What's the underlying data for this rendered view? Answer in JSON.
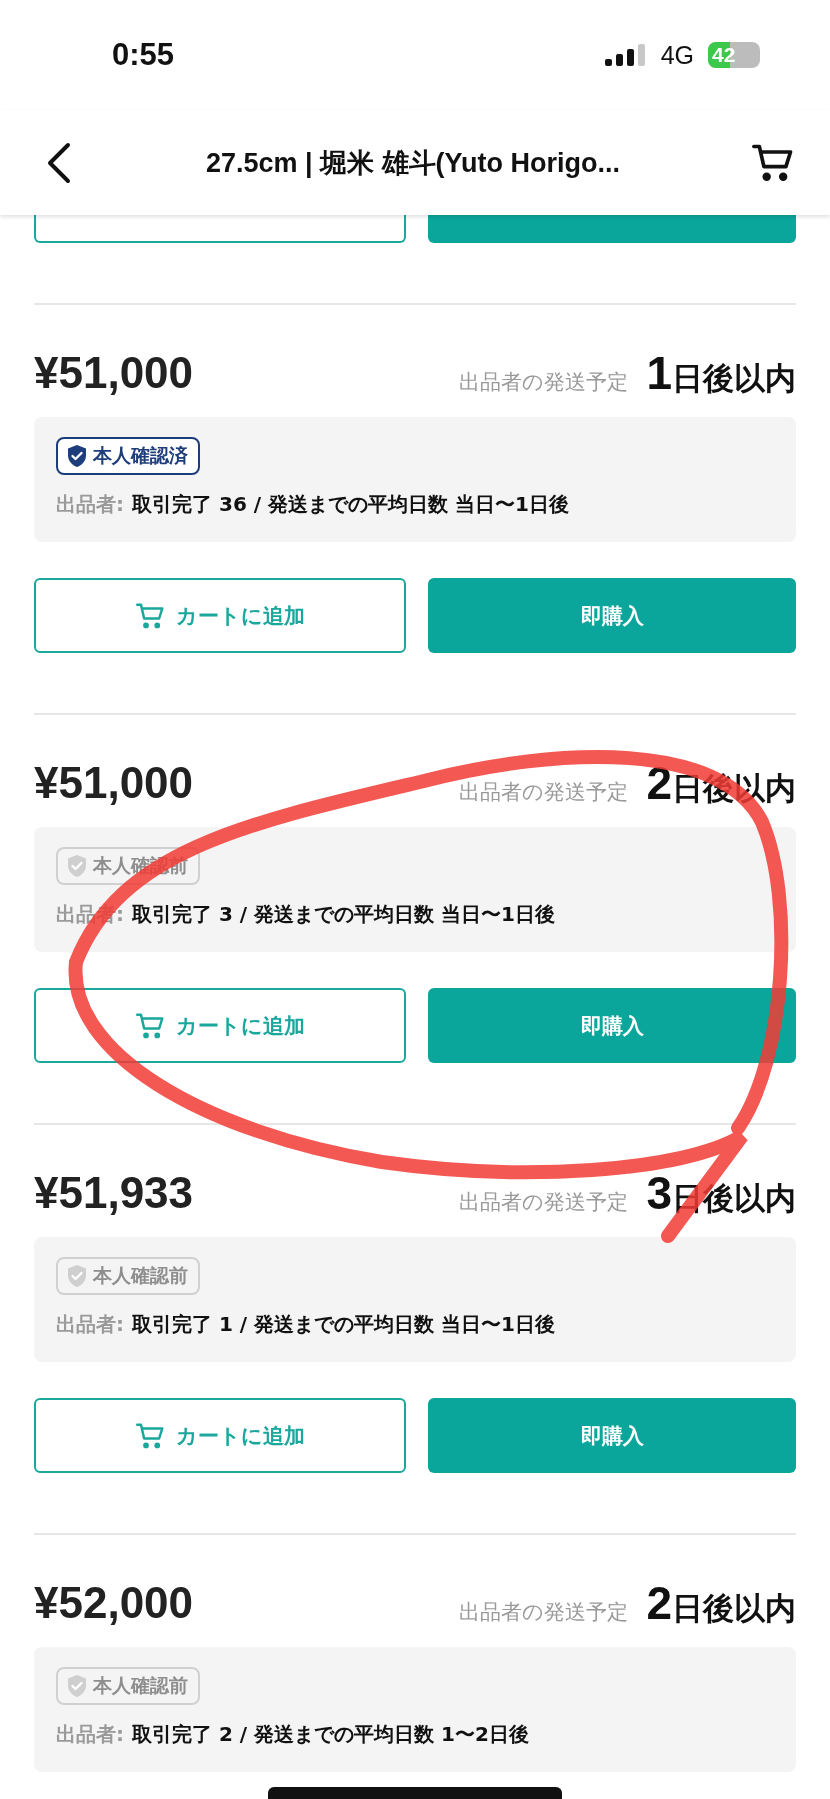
{
  "status_bar": {
    "time": "0:55",
    "network": "4G",
    "battery": "42"
  },
  "header": {
    "title": "27.5cm | 堀米 雄斗(Yuto Horigo..."
  },
  "listings": [
    {
      "price": "¥51,000",
      "shipping_label": "出品者の発送予定",
      "days_number": "1",
      "days_unit": "日後以内",
      "verified": true,
      "badge": "本人確認済",
      "seller_label": "出品者:",
      "seller_stats": "取引完了 36 / 発送までの平均日数 当日〜1日後",
      "cart_button": "カートに追加",
      "buy_button": "即購入"
    },
    {
      "price": "¥51,000",
      "shipping_label": "出品者の発送予定",
      "days_number": "2",
      "days_unit": "日後以内",
      "verified": false,
      "badge": "本人確認前",
      "seller_label": "出品者:",
      "seller_stats": "取引完了 3 / 発送までの平均日数 当日〜1日後",
      "cart_button": "カートに追加",
      "buy_button": "即購入"
    },
    {
      "price": "¥51,933",
      "shipping_label": "出品者の発送予定",
      "days_number": "3",
      "days_unit": "日後以内",
      "verified": false,
      "badge": "本人確認前",
      "seller_label": "出品者:",
      "seller_stats": "取引完了 1 / 発送までの平均日数 当日〜1日後",
      "cart_button": "カートに追加",
      "buy_button": "即購入"
    },
    {
      "price": "¥52,000",
      "shipping_label": "出品者の発送予定",
      "days_number": "2",
      "days_unit": "日後以内",
      "verified": false,
      "badge": "本人確認前",
      "seller_label": "出品者:",
      "seller_stats": "取引完了 2 / 発送までの平均日数 1〜2日後"
    }
  ]
}
